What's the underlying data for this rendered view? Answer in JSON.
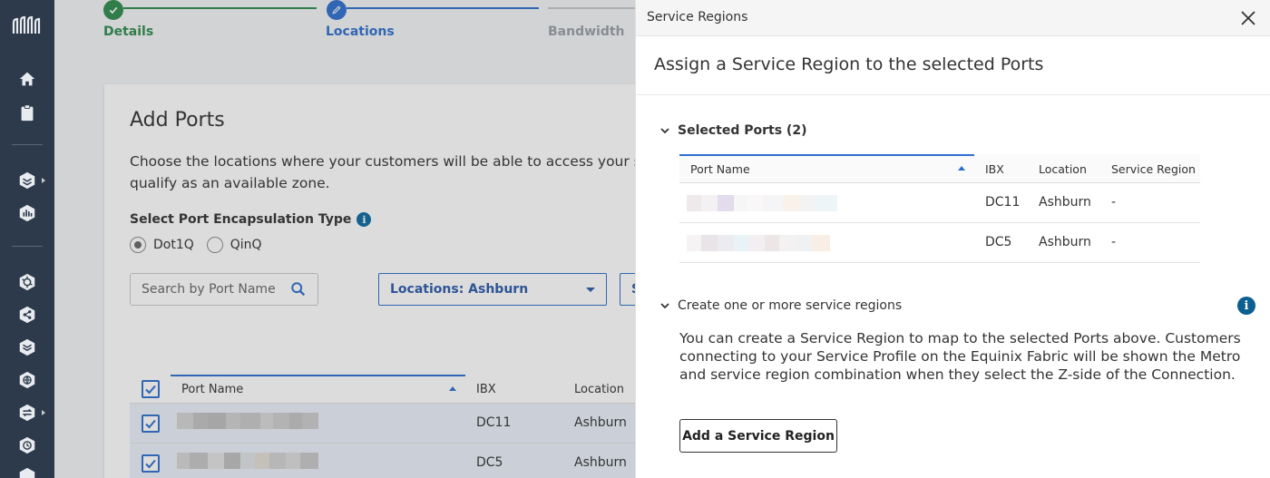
{
  "sidebar": {
    "icons": [
      "equinix-logo-icon",
      "home-icon",
      "clipboard-icon",
      "layers-icon",
      "chart-icon",
      "network-hex-icon",
      "share-icon",
      "stack-icon",
      "globe-icon",
      "transfer-icon",
      "clock-icon",
      "moon-icon"
    ]
  },
  "stepper": {
    "steps": [
      {
        "label": "Details",
        "state": "done"
      },
      {
        "label": "Locations",
        "state": "active"
      },
      {
        "label": "Bandwidth",
        "state": "pending"
      }
    ],
    "colors": {
      "done": "#2e8b4e",
      "active": "#2e6fce",
      "pending": "#9aa0a6"
    }
  },
  "main": {
    "title": "Add Ports",
    "description_line1": "Choose the locations where your customers will be able to access your ser",
    "description_line2": "qualify as an available zone.",
    "encapsulation": {
      "label": "Select Port Encapsulation Type",
      "options": [
        "Dot1Q",
        "QinQ"
      ],
      "selected": "Dot1Q"
    },
    "search_placeholder": "Search by Port Name",
    "location_filter": "Locations: Ashburn",
    "partial_select": "S",
    "table": {
      "columns": [
        "Port Name",
        "IBX",
        "Location"
      ],
      "rows": [
        {
          "ibx": "DC11",
          "location": "Ashburn"
        },
        {
          "ibx": "DC5",
          "location": "Ashburn"
        }
      ]
    }
  },
  "panel": {
    "window_title": "Service Regions",
    "heading": "Assign a Service Region to the selected Ports",
    "selected_ports": {
      "toggle_label": "Selected Ports (2)",
      "columns": [
        "Port Name",
        "IBX",
        "Location",
        "Service Region"
      ],
      "rows": [
        {
          "ibx": "DC11",
          "location": "Ashburn",
          "region": "-"
        },
        {
          "ibx": "DC5",
          "location": "Ashburn",
          "region": "-"
        }
      ]
    },
    "create_section": {
      "toggle_label": "Create one or more service regions",
      "description_line1": "You can create a Service Region to map to the selected Ports above. Customers",
      "description_line2": "connecting to your Service Profile on the Equinix Fabric will be shown the Metro",
      "description_line3": "and service region combination when they select the Z-side of the Connection.",
      "button": "Add a Service Region"
    }
  }
}
